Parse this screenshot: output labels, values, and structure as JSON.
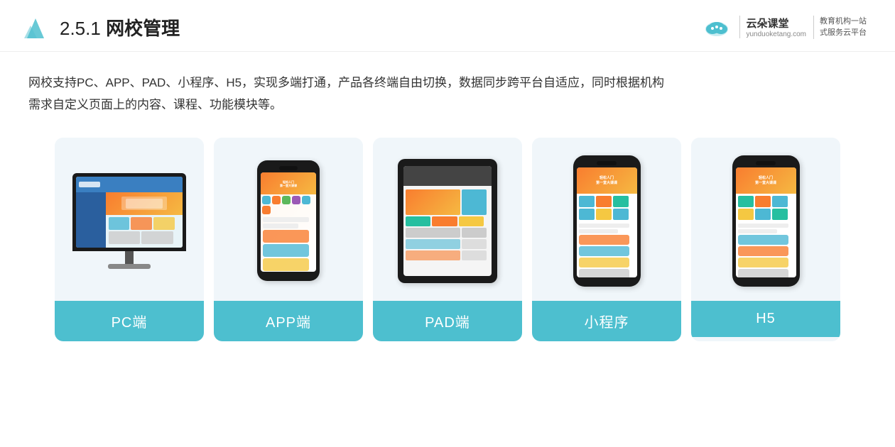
{
  "header": {
    "section_number": "2.5.1",
    "title_prefix": "2.5.1 ",
    "title_bold": "网校管理",
    "brand_name": "云朵课堂",
    "brand_url": "yunduoketang.com",
    "brand_slogan_line1": "教育机构一站",
    "brand_slogan_line2": "式服务云平台"
  },
  "description": {
    "text_line1": "网校支持PC、APP、PAD、小程序、H5，实现多端打通，产品各终端自由切换，数据同步跨平台自适应，同时根据机构",
    "text_line2": "需求自定义页面上的内容、课程、功能模块等。"
  },
  "cards": [
    {
      "id": "pc",
      "label": "PC端",
      "device_type": "pc"
    },
    {
      "id": "app",
      "label": "APP端",
      "device_type": "phone"
    },
    {
      "id": "pad",
      "label": "PAD端",
      "device_type": "pad"
    },
    {
      "id": "miniprogram",
      "label": "小程序",
      "device_type": "mini-phone"
    },
    {
      "id": "h5",
      "label": "H5",
      "device_type": "mini-phone"
    }
  ]
}
